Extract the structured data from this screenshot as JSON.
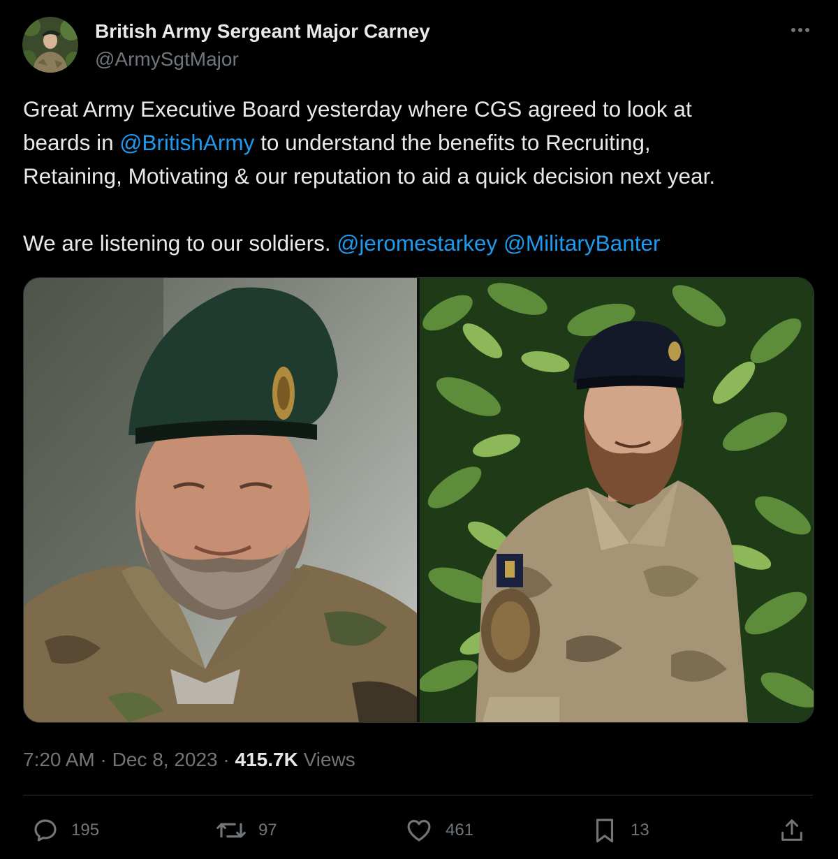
{
  "author": {
    "name": "British Army Sergeant Major Carney",
    "handle": "@ArmySgtMajor"
  },
  "tweet": {
    "line1": "Great Army Executive Board yesterday where CGS agreed to look at",
    "line2_prefix": "beards in ",
    "mention_british_army": "@BritishArmy",
    "line2_suffix": " to understand the benefits to Recruiting,",
    "line3": "Retaining, Motivating & our reputation to aid a quick decision next year.",
    "line4_prefix": "We are listening to our soldiers. ",
    "mention_jerome": "@jeromestarkey",
    "mention_military_banter": "@MilitaryBanter"
  },
  "meta": {
    "time": "7:20 AM",
    "separator": "·",
    "date": "Dec 8, 2023",
    "views_count": "415.7K",
    "views_label": "Views"
  },
  "actions": {
    "replies": "195",
    "reposts": "97",
    "likes": "461",
    "bookmarks": "13"
  },
  "icons": {
    "more": "more-horizontal-icon",
    "reply": "reply-icon",
    "repost": "repost-icon",
    "like": "heart-icon",
    "bookmark": "bookmark-icon",
    "share": "share-icon"
  },
  "colors": {
    "background": "#000000",
    "text": "#e7e9ea",
    "secondary": "#71767b",
    "link": "#1d9bf0",
    "border": "#2f3336"
  }
}
